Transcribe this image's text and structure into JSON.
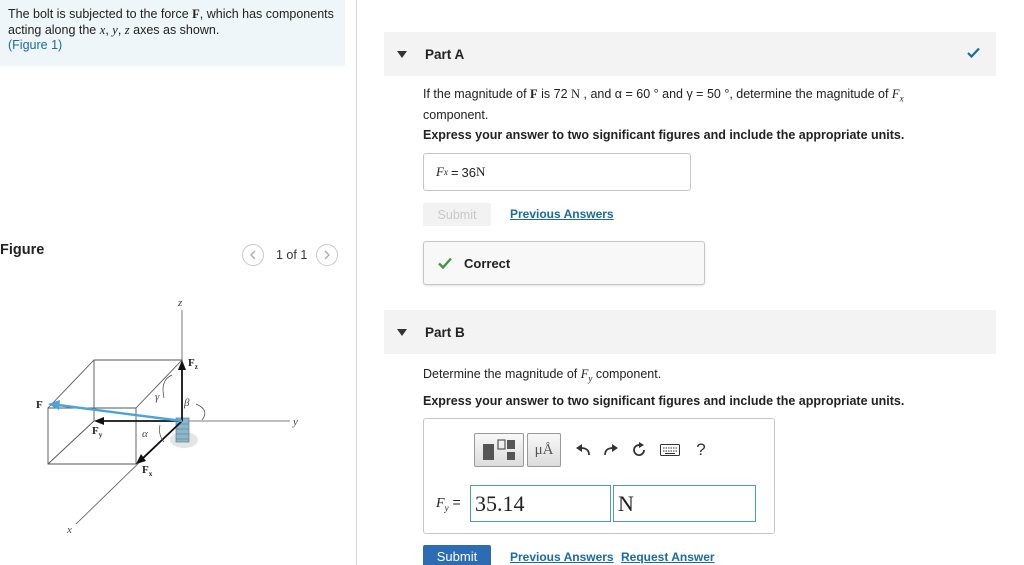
{
  "problem": {
    "text_before": "The bolt is subjected to the force ",
    "force_symbol": "F",
    "text_middle": ", which has components acting along the ",
    "axis_x": "x",
    "sep1": ", ",
    "axis_y": "y",
    "sep2": ", ",
    "axis_z": "z",
    "text_after": " axes as shown.",
    "figure_link": "(Figure 1)"
  },
  "figure": {
    "label": "Figure",
    "pager": "1 of 1",
    "prev_icon": "chevron-left-icon",
    "next_icon": "chevron-right-icon",
    "labels": {
      "z": "z",
      "y": "y",
      "x": "x",
      "F": "F",
      "Fz": "F",
      "Fz_sub": "z",
      "Fy": "F",
      "Fy_sub": "y",
      "Fx": "F",
      "Fx_sub": "x",
      "gamma": "γ",
      "beta": "β",
      "alpha": "α"
    }
  },
  "partA": {
    "title": "Part A",
    "q_1": "If the magnitude of ",
    "q_F": "F",
    "q_2": " is 72 ",
    "q_N": "N",
    "q_3": " , and α = 60 ° and γ = 50 °, determine the magnitude of ",
    "q_Fx": "F",
    "q_Fx_sub": "x",
    "q_4": "component.",
    "instruction": "Express your answer to two significant figures and include the appropriate units.",
    "answer_var": "F",
    "answer_sub": "x",
    "answer_eq": " = ",
    "answer_value": "36",
    "answer_unit": " N",
    "submit": "Submit",
    "previous_answers": "Previous Answers",
    "status": "Correct"
  },
  "partB": {
    "title": "Part B",
    "q_1": "Determine the magnitude of ",
    "q_Fy": "F",
    "q_Fy_sub": "y",
    "q_2": " component.",
    "instruction": "Express your answer to two significant figures and include the appropriate units.",
    "toolbar": {
      "units_label": "μÅ",
      "help": "?"
    },
    "fy_label": "F",
    "fy_sub": "y",
    "fy_eq": " =",
    "value": "35.14",
    "unit": "N",
    "submit": "Submit",
    "previous_answers": "Previous Answers",
    "request_answer": "Request Answer"
  },
  "colors": {
    "accent": "#1a6ba0",
    "correct": "#3c9a3c",
    "force_arrow": "#4aa3d9",
    "submit_active": "#2b6cb5"
  }
}
